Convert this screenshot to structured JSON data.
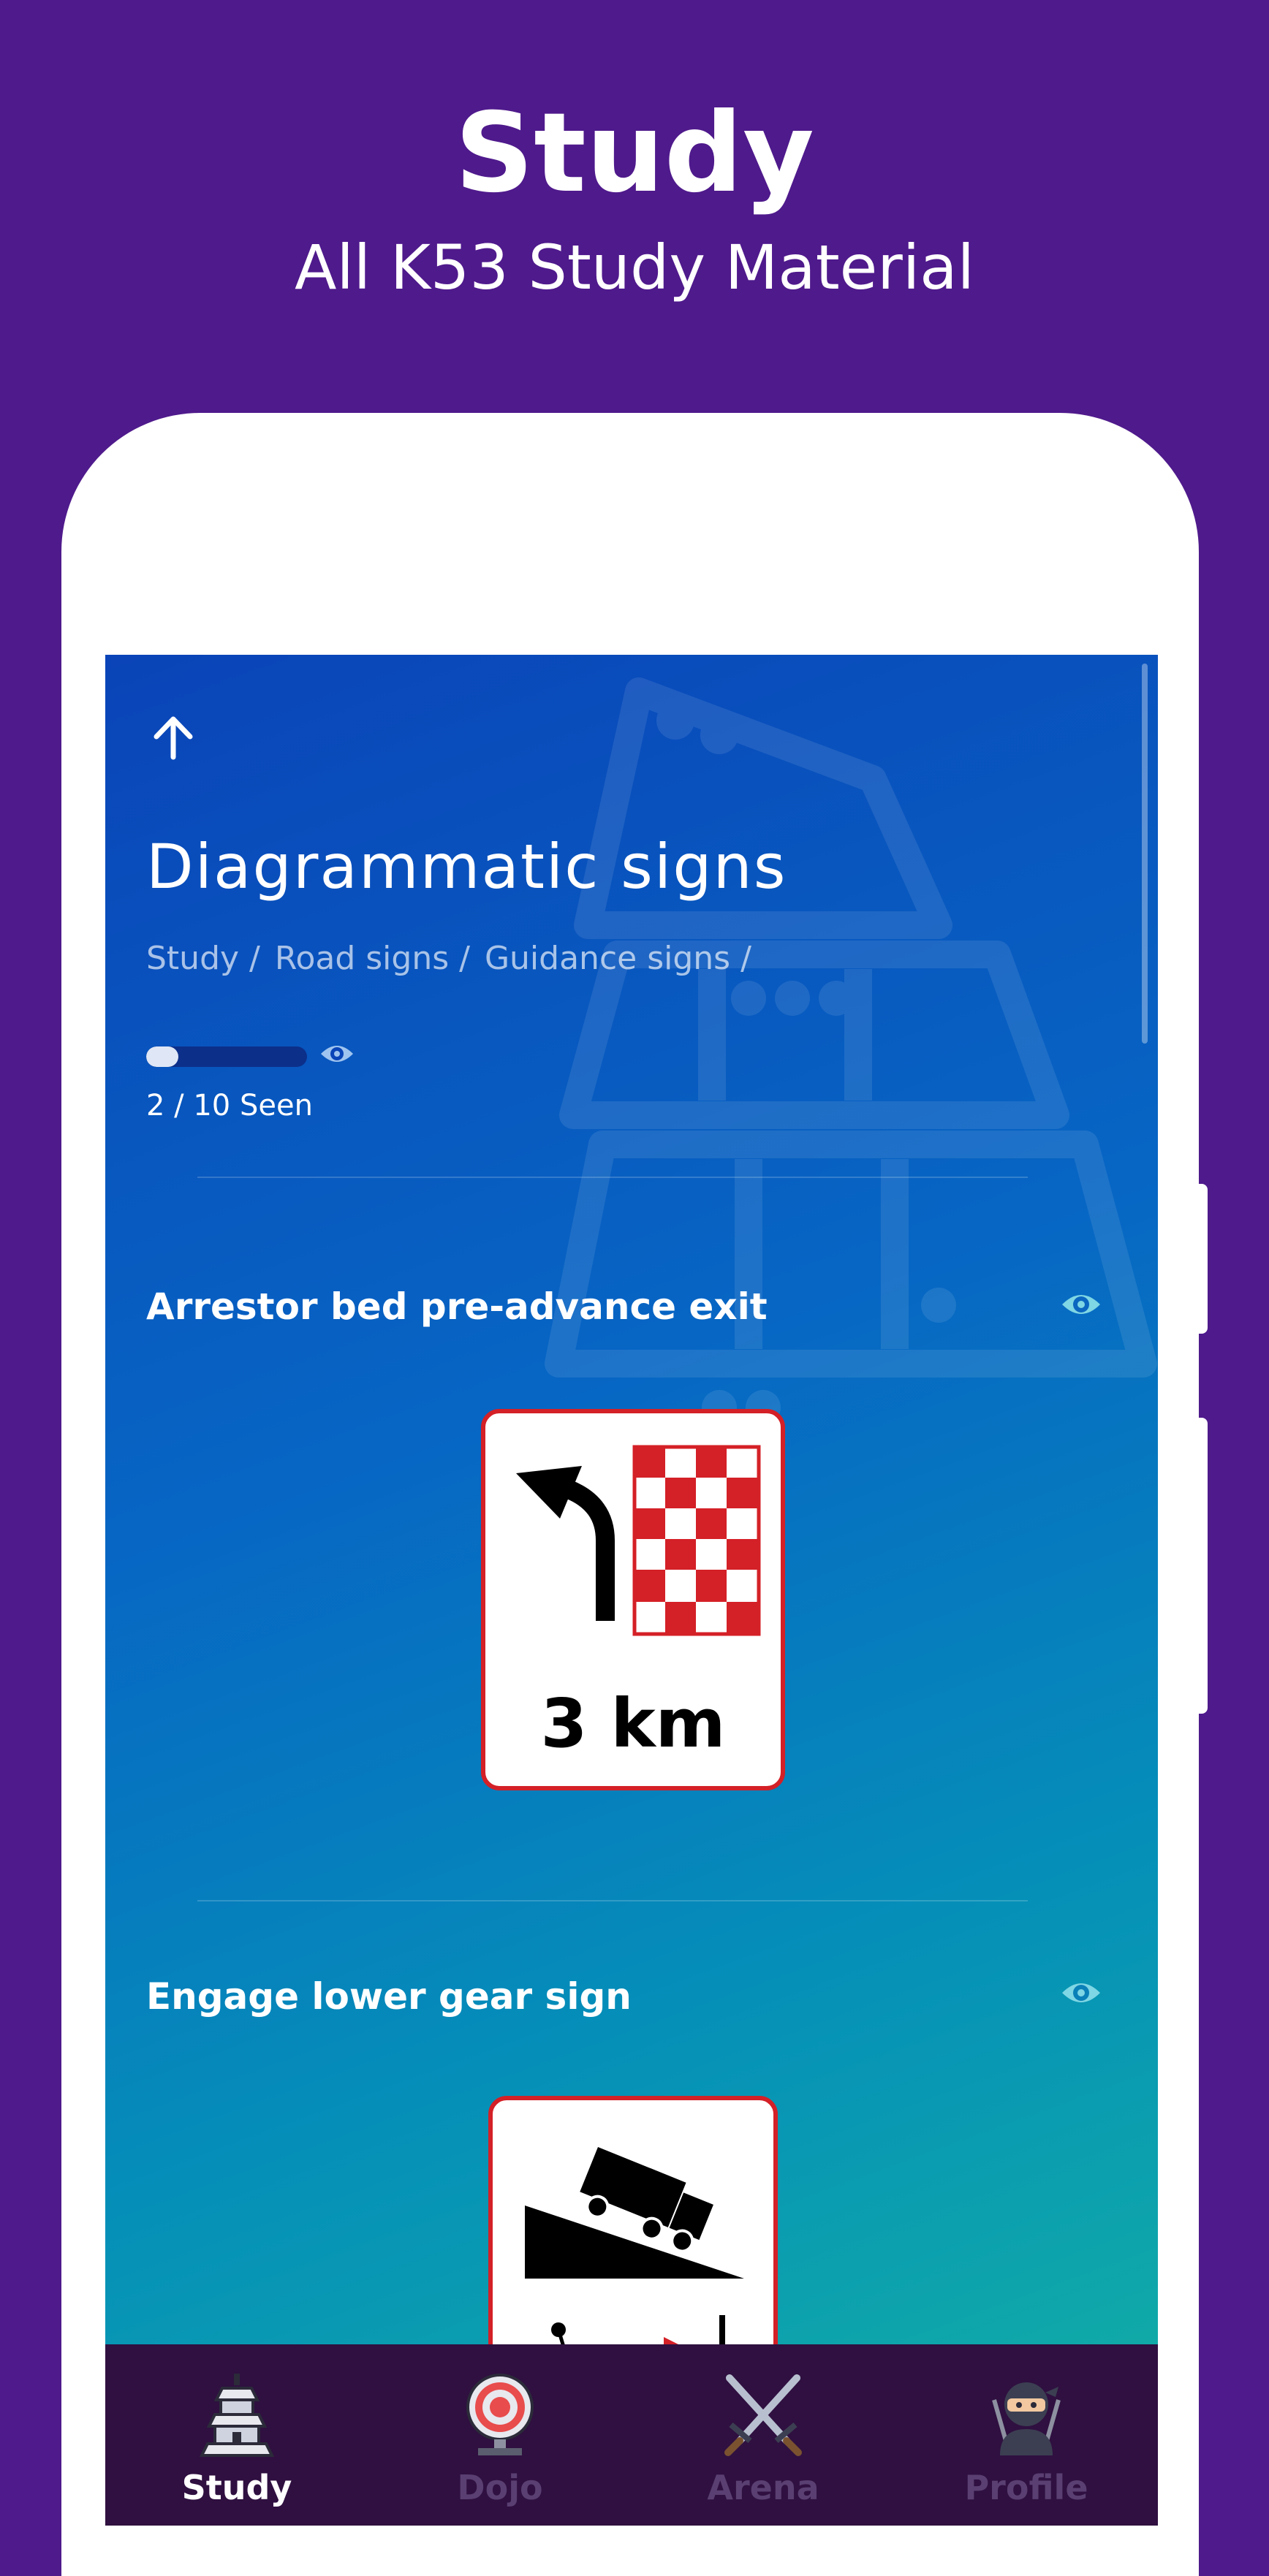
{
  "promo": {
    "title": "Study",
    "subtitle": "All K53 Study Material"
  },
  "header": {
    "title": "Diagrammatic signs",
    "breadcrumb": [
      "Study /",
      "Road signs /",
      "Guidance signs /"
    ]
  },
  "progress": {
    "seen": 2,
    "total": 10,
    "text": "2 / 10 Seen",
    "fraction": 0.2
  },
  "signs": [
    {
      "title": "Arrestor bed pre-advance exit",
      "sign_text": "3 km"
    },
    {
      "title": "Engage lower gear sign"
    }
  ],
  "nav": {
    "items": [
      {
        "label": "Study",
        "icon": "tower-icon",
        "active": true
      },
      {
        "label": "Dojo",
        "icon": "target-icon",
        "active": false
      },
      {
        "label": "Arena",
        "icon": "crossed-swords-icon",
        "active": false
      },
      {
        "label": "Profile",
        "icon": "ninja-icon",
        "active": false
      }
    ]
  },
  "colors": {
    "background": "#4f1a8c",
    "nav_background": "#2f1040",
    "gradient_start": "#0a44b8",
    "gradient_end": "#14b3a2",
    "sign_red": "#d42027"
  }
}
